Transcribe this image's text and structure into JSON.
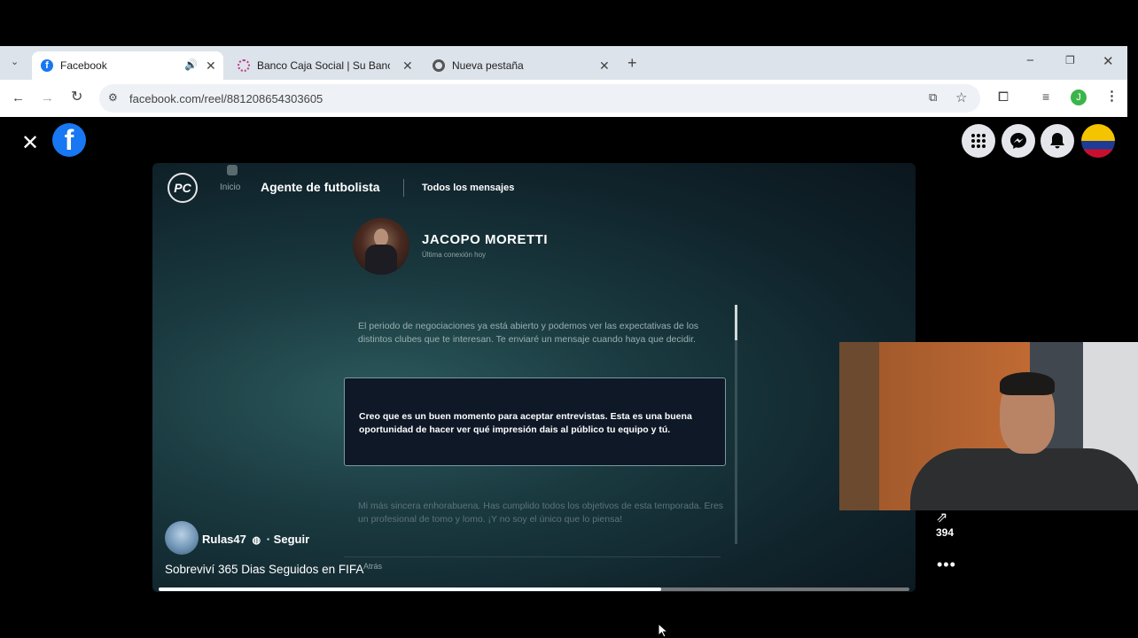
{
  "browser": {
    "tabs": [
      {
        "title": "Facebook",
        "active": true
      },
      {
        "title": "Banco Caja Social | Su Banco Ami",
        "active": false
      },
      {
        "title": "Nueva pestaña",
        "active": false
      }
    ],
    "url": "facebook.com/reel/881208654303605",
    "profile_initial": "J"
  },
  "game": {
    "logo_text": "PC",
    "nav_home": "Inicio",
    "nav_title": "Agente de futbolista",
    "nav_all": "Todos los mensajes",
    "agent_name": "JACOPO MORETTI",
    "agent_status": "Última conexión hoy",
    "messages": [
      "El periodo de negociaciones ya está abierto y podemos ver las expectativas de los distintos clubes que te interesan. Te enviaré un mensaje cuando haya que decidir.",
      "Creo que es un buen momento para aceptar entrevistas. Esta es una buena oportunidad de hacer ver qué impresión dais al público tu equipo y tú.",
      "Mi más sincera enhorabuena. Has cumplido todos los objetivos de esta temporada. Eres un profesional de tomo y lomo. ¡Y no soy el único que lo piensa!"
    ],
    "ghost_text": "Atrás"
  },
  "reel": {
    "username": "Rulas47",
    "follow": "· Seguir",
    "caption": "Sobreviví 365 Dias Seguidos en FIFA",
    "share_count": "394",
    "progress": 0.67
  },
  "colors": {
    "facebook_blue": "#1877f2",
    "chrome_bg": "#dde3ea"
  }
}
